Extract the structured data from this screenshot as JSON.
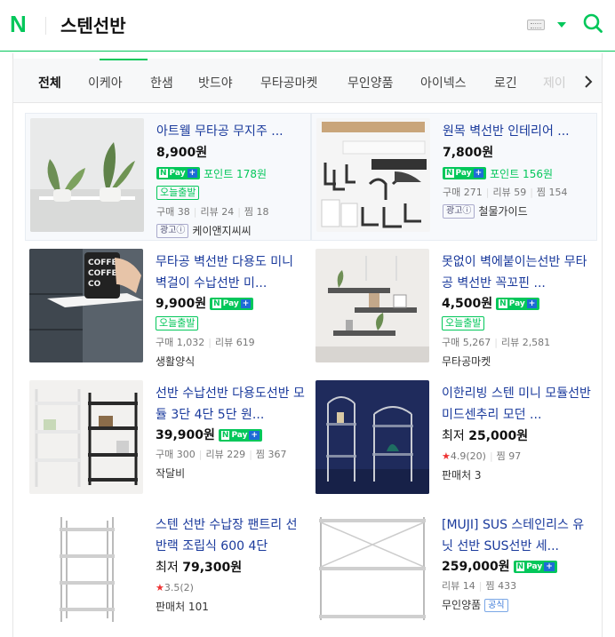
{
  "header": {
    "logo": "N",
    "query": "스텐선반"
  },
  "tabs": [
    {
      "label": "전체",
      "active": true
    },
    {
      "label": "이케아"
    },
    {
      "label": "한샘"
    },
    {
      "label": "밧드야"
    },
    {
      "label": "무타공마켓"
    },
    {
      "label": "무인양품"
    },
    {
      "label": "아이넥스"
    },
    {
      "label": "로긴"
    },
    {
      "label": "제이"
    }
  ],
  "labels": {
    "npay": "N",
    "npay_text": "Pay",
    "plus": "+",
    "point": "포인트",
    "today": "오늘출발",
    "ad": "광고ⓘ",
    "official": "공식",
    "lowest": "최저"
  },
  "products": [
    {
      "title": "아트웰 무타공 무지주 ...",
      "price": "8,900원",
      "point": "포인트 178원",
      "today": true,
      "meta": [
        "구매 38",
        "리뷰 24",
        "찜 18"
      ],
      "seller": "케이앤지씨씨",
      "ad": true,
      "npay": true
    },
    {
      "title": "원목 벽선반 인테리어 ...",
      "price": "7,800원",
      "point": "포인트 156원",
      "meta": [
        "구매 271",
        "리뷰 59",
        "찜 154"
      ],
      "seller": "철물가이드",
      "ad": true,
      "npay": true
    },
    {
      "title": "무타공 벽선반 다용도 미니 벽걸이 수납선반 미...",
      "price": "9,900원",
      "today": true,
      "meta": [
        "구매 1,032",
        "리뷰 619"
      ],
      "seller": "생활양식",
      "npay": true
    },
    {
      "title": "못없이 벽에붙이는선반 무타공 벽선반 꼭꼬핀 ...",
      "price": "4,500원",
      "today": true,
      "meta": [
        "구매 5,267",
        "리뷰 2,581"
      ],
      "seller": "무타공마켓",
      "npay": true
    },
    {
      "title": "선반 수납선반 다용도선반 모듈 3단 4단 5단 원...",
      "price": "39,900원",
      "meta": [
        "구매 300",
        "리뷰 229",
        "찜 367"
      ],
      "seller": "작달비",
      "npay": true
    },
    {
      "title": "이한리빙 스텐 미니 모듈선반 미드센추리 모던 ...",
      "price_prefix": "최저",
      "price": "25,000원",
      "rating": "4.9(20)",
      "meta2": "찜 97",
      "seller": "판매처 3"
    },
    {
      "title": "스텐 선반 수납장 팬트리 선반랙 조립식 600 4단",
      "price_prefix": "최저",
      "price": "79,300원",
      "rating": "3.5(2)",
      "seller": "판매처 101"
    },
    {
      "title": "[MUJI] SUS 스테인리스 유닛 선반 SUS선반 세...",
      "price": "259,000원",
      "meta": [
        "리뷰 14",
        "찜 433"
      ],
      "seller": "무인양품",
      "official": true,
      "npay": true
    }
  ]
}
